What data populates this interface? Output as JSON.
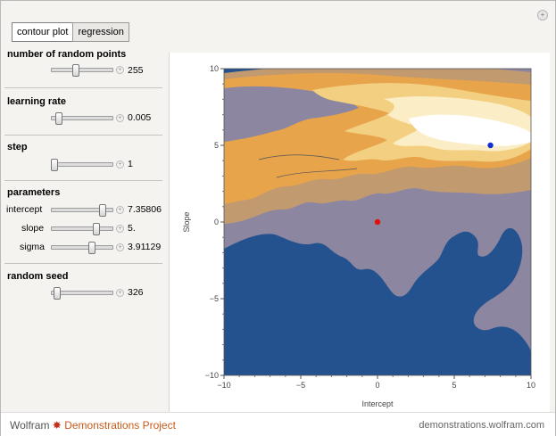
{
  "tabs": [
    {
      "label": "contour plot",
      "active": true
    },
    {
      "label": "regression",
      "active": false
    }
  ],
  "controls": {
    "num_points": {
      "title": "number of random points",
      "value": "255",
      "position": 0.39
    },
    "learning_rate": {
      "title": "learning rate",
      "value": "0.005",
      "position": 0.08
    },
    "step": {
      "title": "step",
      "value": "1",
      "position": 0.0
    },
    "parameters": {
      "title": "parameters",
      "intercept": {
        "label": "intercept",
        "value": "7.35806",
        "position": 0.87
      },
      "slope": {
        "label": "slope",
        "value": "5.",
        "position": 0.75
      },
      "sigma": {
        "label": "sigma",
        "value": "3.91129",
        "position": 0.68
      }
    },
    "random_seed": {
      "title": "random seed",
      "value": "326",
      "position": 0.05
    }
  },
  "plot": {
    "xlabel": "Intercept",
    "ylabel": "Slope",
    "x_ticks": [
      "−10",
      "−5",
      "0",
      "5",
      "10"
    ],
    "y_ticks": [
      "10",
      "5",
      "0",
      "−5",
      "−10"
    ],
    "xlim": [
      -10,
      10
    ],
    "ylim": [
      -10,
      10
    ],
    "red_point": {
      "x": 0,
      "y": 0,
      "color": "#e01010"
    },
    "blue_point": {
      "x": 7.35806,
      "y": 5,
      "color": "#1030d0"
    },
    "colors": {
      "deep": "#23528f",
      "mid": "#8d86a0",
      "tan": "#c29a6f",
      "orange": "#e7a44b",
      "light": "#f3cf82",
      "pale": "#fbeec6"
    }
  },
  "footer": {
    "brand_left": "Wolfram",
    "brand_right": "Demonstrations Project",
    "site": "demonstrations.wolfram.com"
  }
}
